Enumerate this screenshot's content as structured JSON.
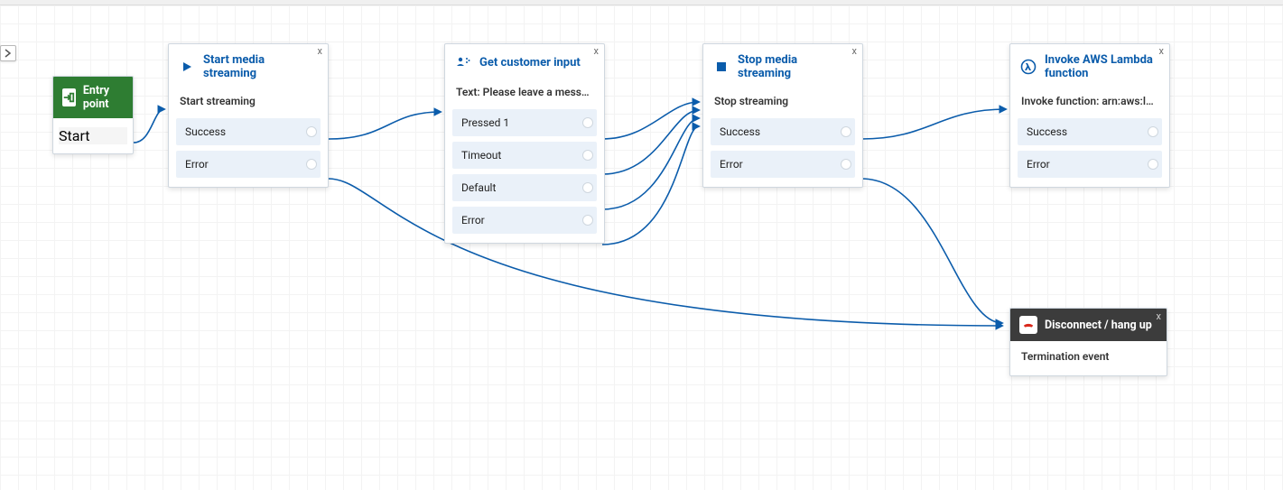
{
  "toolbar": {
    "expand_label": "expand"
  },
  "entry": {
    "title": "Entry point",
    "branches": [
      {
        "label": "Start"
      }
    ]
  },
  "nodes": {
    "start_media": {
      "title": "Start media streaming",
      "subheader": "Start streaming",
      "branches": [
        {
          "label": "Success"
        },
        {
          "label": "Error"
        }
      ]
    },
    "get_input": {
      "title": "Get customer input",
      "subheader": "Text: Please leave a messag...",
      "branches": [
        {
          "label": "Pressed 1"
        },
        {
          "label": "Timeout"
        },
        {
          "label": "Default"
        },
        {
          "label": "Error"
        }
      ]
    },
    "stop_media": {
      "title": "Stop media streaming",
      "subheader": "Stop streaming",
      "branches": [
        {
          "label": "Success"
        },
        {
          "label": "Error"
        }
      ]
    },
    "lambda": {
      "title": "Invoke AWS Lambda function",
      "subheader": "Invoke function:  arn:aws:la...",
      "branches": [
        {
          "label": "Success"
        },
        {
          "label": "Error"
        }
      ]
    }
  },
  "disconnect": {
    "title": "Disconnect / hang up",
    "body": "Termination event"
  },
  "colors": {
    "link": "#0b5cab",
    "node_border": "#cfd7df",
    "green": "#2e7d32",
    "dark": "#3c3c3c",
    "branch_bg": "#eaf1f9"
  },
  "close_label": "x"
}
